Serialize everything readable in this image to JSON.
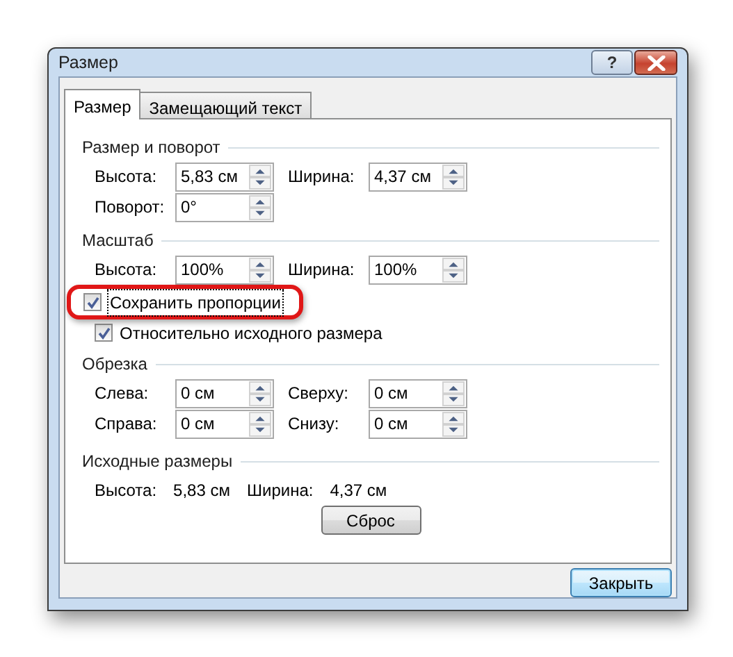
{
  "window": {
    "title": "Размер",
    "help_label": "?"
  },
  "tabs": [
    {
      "label": "Размер",
      "selected": true
    },
    {
      "label": "Замещающий текст",
      "selected": false
    }
  ],
  "sections": [
    {
      "title": "Размер и поворот",
      "kind": "fields",
      "rows": [
        [
          {
            "label": "Высота:",
            "value": "5,83 см"
          },
          {
            "label": "Ширина:",
            "value": "4,37 см"
          }
        ],
        [
          {
            "label": "Поворот:",
            "value": "0°"
          }
        ]
      ]
    },
    {
      "title": "Масштаб",
      "kind": "fields",
      "rows": [
        [
          {
            "label": "Высота:",
            "value": "100%"
          },
          {
            "label": "Ширина:",
            "value": "100%"
          }
        ]
      ],
      "checkboxes": [
        {
          "label": "Сохранить пропорции",
          "checked": true,
          "focused": true,
          "highlighted": true
        },
        {
          "label": "Относительно исходного размера",
          "checked": true,
          "focused": false,
          "highlighted": false
        }
      ]
    },
    {
      "title": "Обрезка",
      "kind": "fields",
      "rows": [
        [
          {
            "label": "Слева:",
            "value": "0 см"
          },
          {
            "label": "Сверху:",
            "value": "0 см"
          }
        ],
        [
          {
            "label": "Справа:",
            "value": "0 см"
          },
          {
            "label": "Снизу:",
            "value": "0 см"
          }
        ]
      ]
    },
    {
      "title": "Исходные размеры",
      "kind": "info",
      "items": [
        {
          "label": "Высота:",
          "value": "5,83 см"
        },
        {
          "label": "Ширина:",
          "value": "4,37 см"
        }
      ],
      "button": "Сброс"
    }
  ],
  "footer_button": "Закрыть"
}
